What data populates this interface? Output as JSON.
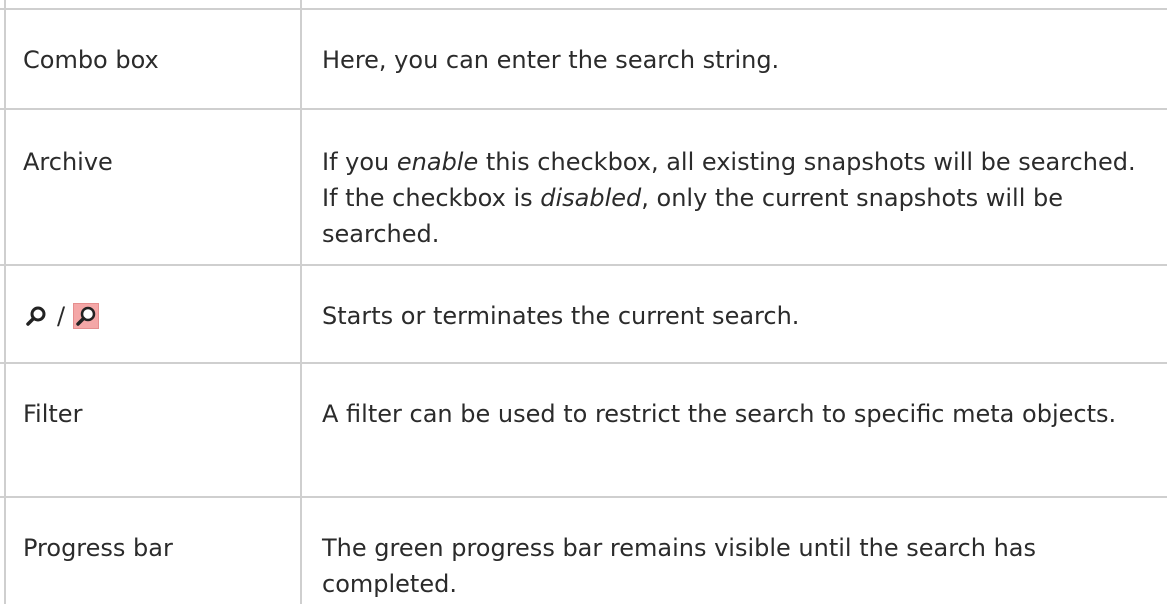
{
  "rows": [
    {
      "term": "Combo box",
      "description": "Here, you can enter the search string."
    },
    {
      "term": "Archive",
      "description_parts": [
        "If you ",
        "enable",
        " this checkbox, all existing snapshots will be searched. If the checkbox is ",
        "disabled",
        ", only the current snapshots will be searched."
      ]
    },
    {
      "term_icons": [
        "search-icon",
        "search-icon-active"
      ],
      "term_separator": "/",
      "description": "Starts or terminates the current search."
    },
    {
      "term": "Filter",
      "description": "A filter can be used to restrict the search to specific meta objects."
    },
    {
      "term": "Progress bar",
      "description": "The green progress bar remains visible until the search has completed."
    }
  ],
  "colors": {
    "grid_line": "#cfcfcf",
    "text": "#2b2b2b",
    "active_icon_bg": "#f4a7a7"
  }
}
